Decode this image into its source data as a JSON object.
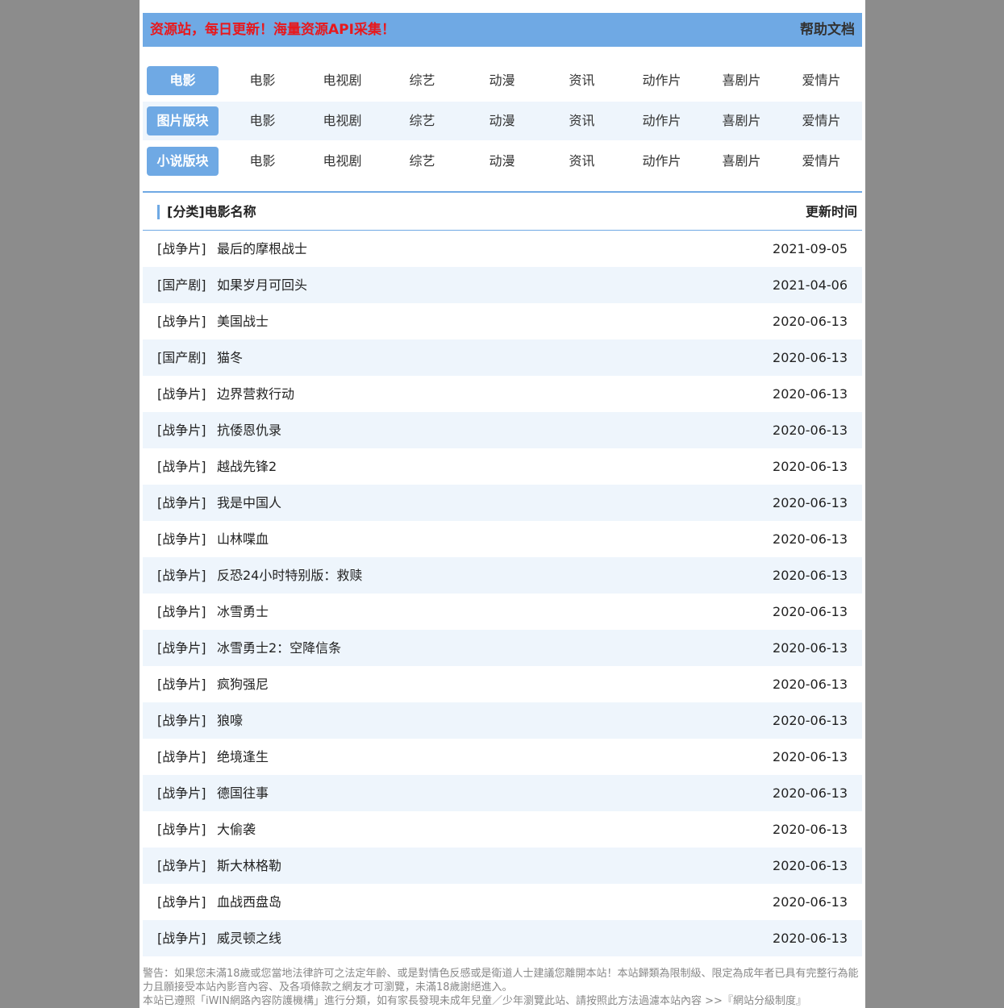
{
  "header": {
    "site_title": "资源站，每日更新！海量资源API采集！",
    "help_label": "帮助文档"
  },
  "nav_rows": [
    {
      "label": "电影",
      "items": [
        "电影",
        "电视剧",
        "综艺",
        "动漫",
        "资讯",
        "动作片",
        "喜剧片",
        "爱情片"
      ]
    },
    {
      "label": "图片版块",
      "items": [
        "电影",
        "电视剧",
        "综艺",
        "动漫",
        "资讯",
        "动作片",
        "喜剧片",
        "爱情片"
      ]
    },
    {
      "label": "小说版块",
      "items": [
        "电影",
        "电视剧",
        "综艺",
        "动漫",
        "资讯",
        "动作片",
        "喜剧片",
        "爱情片"
      ]
    }
  ],
  "list": {
    "header_name": "[分类]电影名称",
    "header_time": "更新时间",
    "rows": [
      {
        "category": "[战争片]",
        "title": "最后的摩根战士",
        "date": "2021-09-05"
      },
      {
        "category": "[国产剧]",
        "title": "如果岁月可回头",
        "date": "2021-04-06"
      },
      {
        "category": "[战争片]",
        "title": "美国战士",
        "date": "2020-06-13"
      },
      {
        "category": "[国产剧]",
        "title": "猫冬",
        "date": "2020-06-13"
      },
      {
        "category": "[战争片]",
        "title": "边界营救行动",
        "date": "2020-06-13"
      },
      {
        "category": "[战争片]",
        "title": "抗倭恩仇录",
        "date": "2020-06-13"
      },
      {
        "category": "[战争片]",
        "title": "越战先锋2",
        "date": "2020-06-13"
      },
      {
        "category": "[战争片]",
        "title": "我是中国人",
        "date": "2020-06-13"
      },
      {
        "category": "[战争片]",
        "title": "山林喋血",
        "date": "2020-06-13"
      },
      {
        "category": "[战争片]",
        "title": "反恐24小时特别版：救赎",
        "date": "2020-06-13"
      },
      {
        "category": "[战争片]",
        "title": "冰雪勇士",
        "date": "2020-06-13"
      },
      {
        "category": "[战争片]",
        "title": "冰雪勇士2：空降信条",
        "date": "2020-06-13"
      },
      {
        "category": "[战争片]",
        "title": "疯狗强尼",
        "date": "2020-06-13"
      },
      {
        "category": "[战争片]",
        "title": "狼嚎",
        "date": "2020-06-13"
      },
      {
        "category": "[战争片]",
        "title": "绝境逢生",
        "date": "2020-06-13"
      },
      {
        "category": "[战争片]",
        "title": "德国往事",
        "date": "2020-06-13"
      },
      {
        "category": "[战争片]",
        "title": "大偷袭",
        "date": "2020-06-13"
      },
      {
        "category": "[战争片]",
        "title": "斯大林格勒",
        "date": "2020-06-13"
      },
      {
        "category": "[战争片]",
        "title": "血战西盘岛",
        "date": "2020-06-13"
      },
      {
        "category": "[战争片]",
        "title": "威灵顿之线",
        "date": "2020-06-13"
      }
    ]
  },
  "footer": {
    "warning": "警告：如果您未滿18歲或您當地法律許可之法定年齡、或是對情色反感或是衛道人士建議您離開本站！本站歸類為限制級、限定為成年者已具有完整行為能力且願接受本站內影音內容、及各項條款之網友才可瀏覽，未滿18歲謝絕進入。",
    "notice": "本站已遵照「iWIN網路內容防護機構」進行分類，如有家長發現未成年兒童／少年瀏覽此站、請按照此方法過濾本站內容 >>『網站分級制度』"
  },
  "colors": {
    "accent": "#6fa9e4",
    "title_red": "#e8181c",
    "row_alt": "#eef5fc",
    "backdrop": "#8c8c8c"
  }
}
